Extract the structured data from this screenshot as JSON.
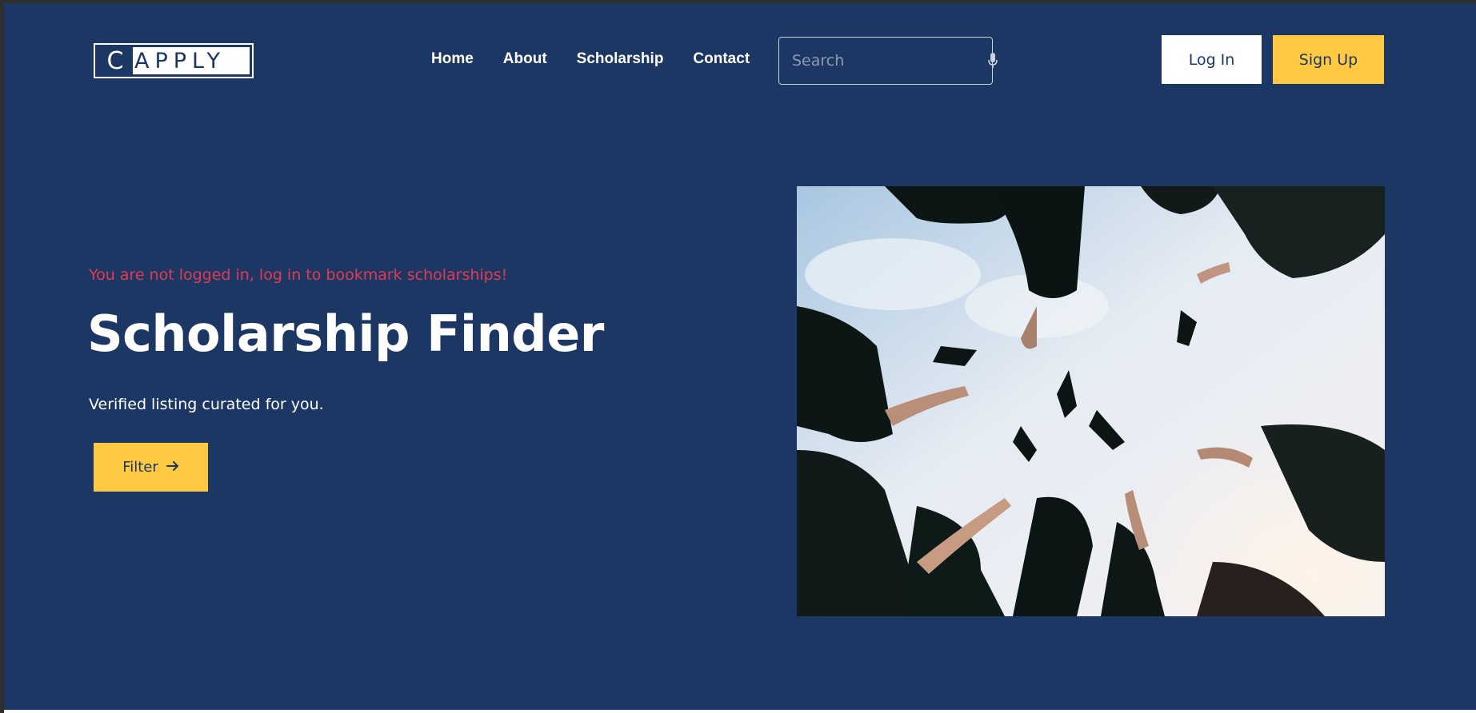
{
  "brand": {
    "logo_letter": "C",
    "logo_rest": "APPLY"
  },
  "nav": {
    "items": [
      {
        "label": "Home"
      },
      {
        "label": "About"
      },
      {
        "label": "Scholarship"
      },
      {
        "label": "Contact"
      }
    ]
  },
  "search": {
    "placeholder": "Search",
    "value": ""
  },
  "auth": {
    "login_label": "Log In",
    "signup_label": "Sign Up"
  },
  "hero": {
    "notice": "You are not logged in, log in to bookmark scholarships!",
    "title": "Scholarship Finder",
    "subtitle": "Verified listing curated for you.",
    "filter_label": "Filter"
  },
  "icons": {
    "search_mic": "microphone-icon",
    "filter_arrow": "arrow-right-icon"
  },
  "colors": {
    "background": "#1d3764",
    "accent": "#ffc942",
    "notice": "#e23a52",
    "text": "#ffffff"
  }
}
